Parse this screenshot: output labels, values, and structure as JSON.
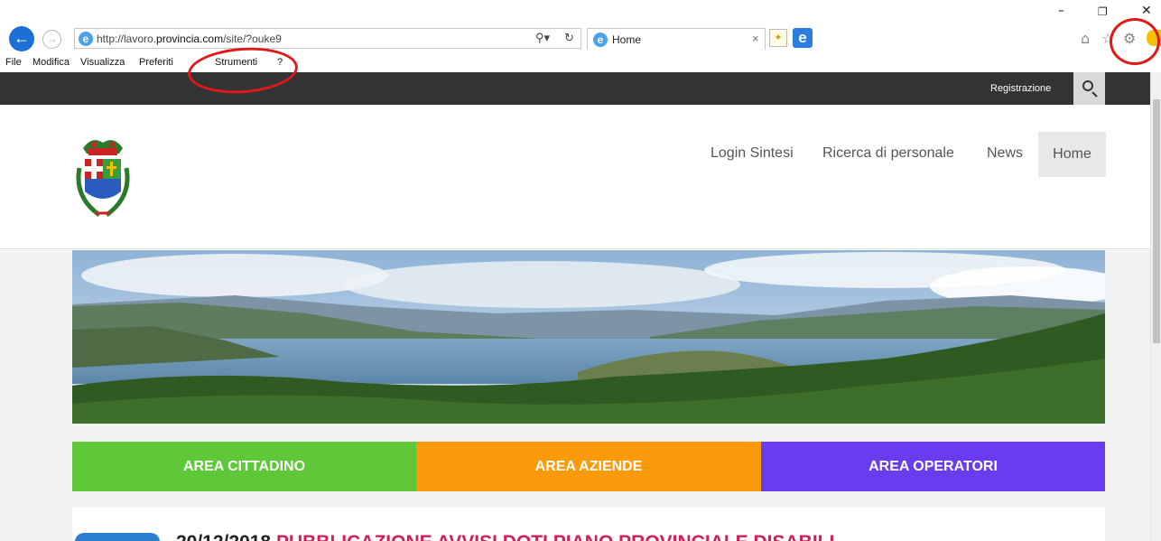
{
  "window": {
    "minimize": "–",
    "restore": "❐",
    "close": "✕"
  },
  "browser": {
    "url_prefix": "http://lavoro.",
    "url_host": "provincia.com",
    "url_rest": "/site/?ouke9",
    "tab_title": "Home",
    "icons": [
      "back-arrow-icon",
      "forward-arrow-icon",
      "ie-logo-icon",
      "search-icon",
      "refresh-icon",
      "tab-close-icon",
      "new-tab-icon",
      "edge-icon",
      "home-icon",
      "favorites-star-icon",
      "gear-icon",
      "smiley-icon"
    ]
  },
  "menu": {
    "items": [
      "File",
      "Modifica",
      "Visualizza",
      "Preferiti",
      "Strumenti",
      "?"
    ]
  },
  "annotations": {
    "color": "#e01818"
  },
  "site": {
    "topbar": {
      "registration": "Registrazione"
    },
    "nav": {
      "items": [
        "Login Sintesi",
        "Ricerca di personale",
        "News",
        "Home"
      ],
      "active": "Home"
    },
    "areas": [
      {
        "label": "AREA CITTADINO",
        "color": "#5fc838"
      },
      {
        "label": "AREA AZIENDE",
        "color": "#fb9b0b"
      },
      {
        "label": "AREA OPERATORI",
        "color": "#6a3cf0"
      }
    ],
    "news": {
      "date": "20/12/2018",
      "title": "PUBBLICAZIONE AVVISI DOTI PIANO PROVINCIALE DISABILI"
    }
  }
}
